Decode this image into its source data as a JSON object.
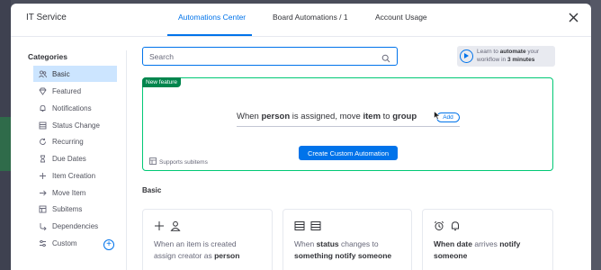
{
  "header": {
    "title": "IT Service",
    "tabs": [
      {
        "label": "Automations Center",
        "active": true
      },
      {
        "label": "Board Automations / 1",
        "active": false
      },
      {
        "label": "Account Usage",
        "active": false
      }
    ],
    "close_icon": "close-icon"
  },
  "sidebar": {
    "heading": "Categories",
    "items": [
      {
        "label": "Basic",
        "icon": "people-icon",
        "active": true
      },
      {
        "label": "Featured",
        "icon": "diamond-icon",
        "active": false
      },
      {
        "label": "Notifications",
        "icon": "bell-icon",
        "active": false
      },
      {
        "label": "Status Change",
        "icon": "columns-icon",
        "active": false
      },
      {
        "label": "Recurring",
        "icon": "refresh-icon",
        "active": false
      },
      {
        "label": "Due Dates",
        "icon": "hourglass-icon",
        "active": false
      },
      {
        "label": "Item Creation",
        "icon": "plus-icon",
        "active": false
      },
      {
        "label": "Move Item",
        "icon": "arrow-right-icon",
        "active": false
      },
      {
        "label": "Subitems",
        "icon": "subitems-icon",
        "active": false
      },
      {
        "label": "Dependencies",
        "icon": "dependency-icon",
        "active": false
      },
      {
        "label": "Custom",
        "icon": "sliders-icon",
        "active": false
      }
    ]
  },
  "search": {
    "placeholder": "Search",
    "value": ""
  },
  "learn": {
    "prefix": "Learn to ",
    "bold1": "automate",
    "mid": " your workflow in ",
    "bold2": "3 minutes"
  },
  "feature": {
    "badge": "New feature",
    "sentence": [
      {
        "text": "When ",
        "bold": false
      },
      {
        "text": "person",
        "bold": true
      },
      {
        "text": " is assigned, move ",
        "bold": false
      },
      {
        "text": "item",
        "bold": true
      },
      {
        "text": " to ",
        "bold": false
      },
      {
        "text": "group",
        "bold": true
      }
    ],
    "add_label": "Add",
    "create_button": "Create Custom Automation",
    "supports": "Supports subitems"
  },
  "section_label": "Basic",
  "cards": [
    {
      "icons": [
        "plus-icon",
        "person-icon"
      ],
      "line1": [
        {
          "text": "When an item is created",
          "bold": false
        }
      ],
      "line2": [
        {
          "text": "assign creator as ",
          "bold": false
        },
        {
          "text": "person",
          "bold": true
        }
      ]
    },
    {
      "icons": [
        "columns-icon",
        "columns-icon"
      ],
      "line1": [
        {
          "text": "When ",
          "bold": false
        },
        {
          "text": "status",
          "bold": true
        },
        {
          "text": " changes to",
          "bold": false
        }
      ],
      "line2": [
        {
          "text": "something notify someone",
          "bold": true
        }
      ]
    },
    {
      "icons": [
        "clock-icon",
        "bell-icon"
      ],
      "line1": [
        {
          "text": "When date",
          "bold": true
        },
        {
          "text": " arrives ",
          "bold": false
        },
        {
          "text": "notify",
          "bold": true
        }
      ],
      "line2": [
        {
          "text": "someone",
          "bold": true
        }
      ]
    }
  ],
  "colors": {
    "accent": "#0073ea",
    "feature_border": "#00c875",
    "badge": "#00854d",
    "active_row": "#cce5ff"
  }
}
